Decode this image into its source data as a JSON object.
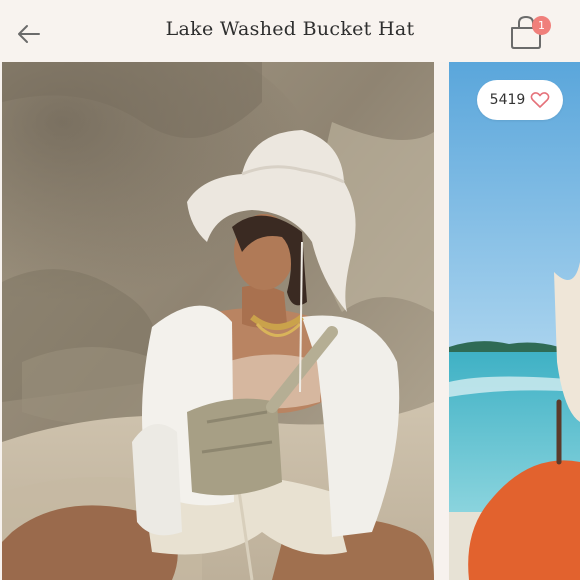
{
  "header": {
    "title": "Lake Washed Bucket Hat",
    "back_icon": "arrow-left-icon",
    "cart_icon": "shopping-bag-icon",
    "cart_count": "1"
  },
  "listing": {
    "like_count": "5419",
    "like_icon": "heart-outline-icon"
  },
  "colors": {
    "accent_badge": "#f07f7b",
    "like_heart": "#e5727a",
    "header_bg": "#f8f3ef"
  }
}
